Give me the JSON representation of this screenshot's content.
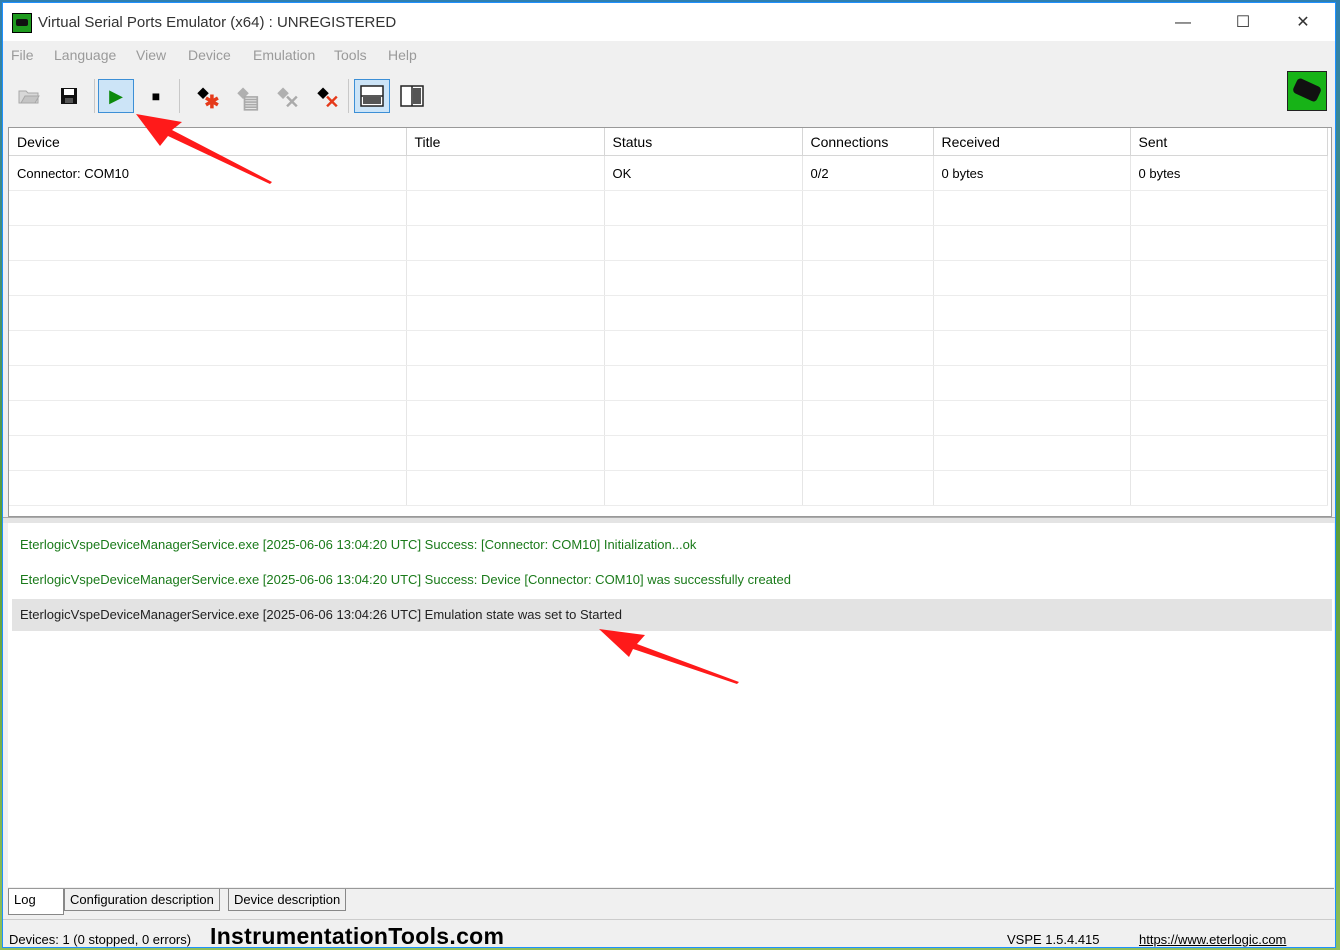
{
  "window": {
    "title": "Virtual Serial Ports Emulator (x64) : UNREGISTERED",
    "minimize": "—",
    "maximize": "☐",
    "close": "✕"
  },
  "menu": [
    "File",
    "Language",
    "View",
    "Device",
    "Emulation",
    "Tools",
    "Help"
  ],
  "toolbar": {
    "icons": [
      "open-icon",
      "save-icon",
      "start-emulation-icon",
      "stop-emulation-icon",
      "create-device-icon",
      "edit-device-icon",
      "remove-device-icon",
      "delete-all-devices-icon",
      "horizontal-layout-icon",
      "vertical-layout-icon"
    ],
    "play_glyph": "▶",
    "stop_glyph": "■"
  },
  "devices_table": {
    "columns": [
      "Device",
      "Title",
      "Status",
      "Connections",
      "Received",
      "Sent"
    ],
    "rows": [
      [
        "Connector: COM10",
        "",
        "OK",
        "0/2",
        "0 bytes",
        "0 bytes"
      ]
    ]
  },
  "log": [
    {
      "text": "EterlogicVspeDeviceManagerService.exe [2025-06-06 13:04:20 UTC] Success: [Connector: COM10] Initialization...ok",
      "color": "#1a7a1a"
    },
    {
      "text": "EterlogicVspeDeviceManagerService.exe [2025-06-06 13:04:20 UTC] Success: Device [Connector: COM10] was successfully created",
      "color": "#1a7a1a"
    },
    {
      "text": "EterlogicVspeDeviceManagerService.exe [2025-06-06 13:04:26 UTC] Emulation state was set to Started",
      "color": "#222222"
    }
  ],
  "tabs": [
    "Log",
    "Configuration description",
    "Device description"
  ],
  "status": {
    "devices": "Devices: 1 (0 stopped, 0 errors)",
    "watermark": "InstrumentationTools.com",
    "version": "VSPE 1.5.4.415",
    "url": "https://www.eterlogic.com"
  },
  "colors": {
    "accent": "#3c8fd6",
    "arrow": "#ff1a1a",
    "log_success": "#1a7a1a"
  }
}
